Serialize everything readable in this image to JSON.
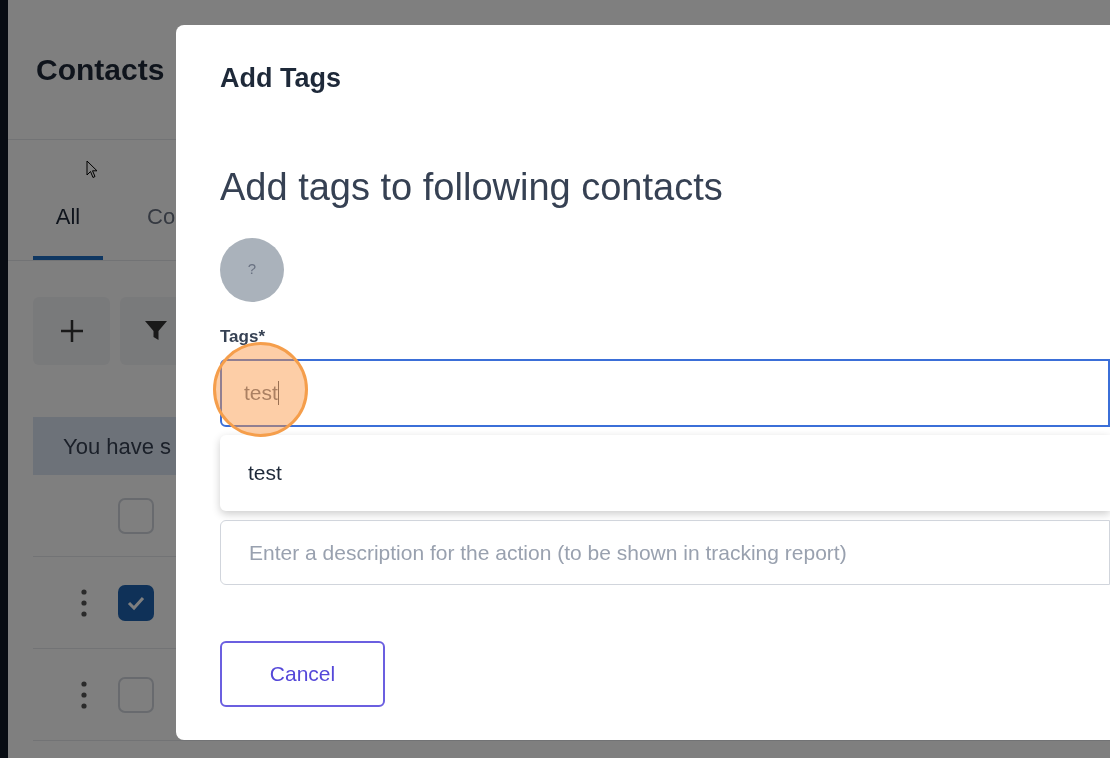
{
  "background": {
    "title": "Contacts",
    "tabs": [
      {
        "label": "All",
        "selected": true
      },
      {
        "label": "Co",
        "selected": false
      }
    ],
    "toolbar": [
      {
        "kind": "add"
      },
      {
        "kind": "filter"
      }
    ],
    "banner": "You have s",
    "rows": [
      {
        "kind": "header",
        "checked": false
      },
      {
        "kind": "contact",
        "checked": true
      },
      {
        "kind": "contact",
        "checked": false
      }
    ]
  },
  "modal": {
    "title": "Add Tags",
    "heading": "Add tags to following contacts",
    "avatar": "?",
    "tags_field": {
      "label": "Tags*",
      "value": "test",
      "focused": true
    },
    "suggestions": [
      "test"
    ],
    "description_field": {
      "placeholder": "Enter a description for the action (to be shown in tracking report)"
    },
    "buttons": [
      "Cancel"
    ],
    "click_marker": true
  }
}
